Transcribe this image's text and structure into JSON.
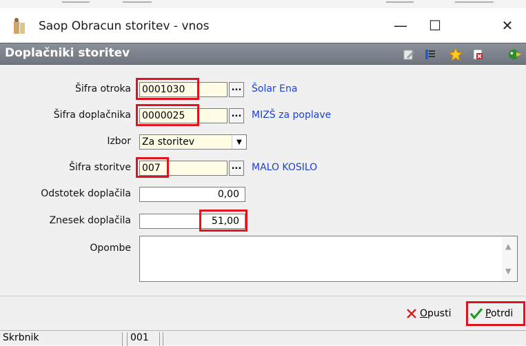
{
  "window": {
    "title": "Saop Obracun storitev - vnos",
    "minimize": "—",
    "maximize": "☐",
    "close": "✕"
  },
  "header": {
    "title": "Doplačniki storitev"
  },
  "form": {
    "sifra_otroka": {
      "label": "Šifra otroka",
      "value": "0001030",
      "lookup": "...",
      "name": "Šolar Ena"
    },
    "sifra_doplacnika": {
      "label": "Šifra doplačnika",
      "value": "0000025",
      "lookup": "...",
      "name": "MIZŠ za poplave"
    },
    "izbor": {
      "label": "Izbor",
      "value": "Za storitev"
    },
    "sifra_storitve": {
      "label": "Šifra storitve",
      "value": "007",
      "lookup": "...",
      "name": "MALO KOSILO"
    },
    "odstotek": {
      "label": "Odstotek doplačila",
      "value": "0,00"
    },
    "znesek": {
      "label": "Znesek doplačila",
      "value": "51,00"
    },
    "opombe": {
      "label": "Opombe",
      "value": ""
    }
  },
  "footer": {
    "cancel_mnemonic": "O",
    "cancel_rest": "pusti",
    "confirm_mnemonic": "P",
    "confirm_rest": "otrdi"
  },
  "status": {
    "user": "Skrbnik",
    "code": "001"
  },
  "colors": {
    "highlight": "#e0141e",
    "link": "#1a3fd9",
    "header_bg": "#7b818a",
    "input_bg": "#fffde6"
  }
}
